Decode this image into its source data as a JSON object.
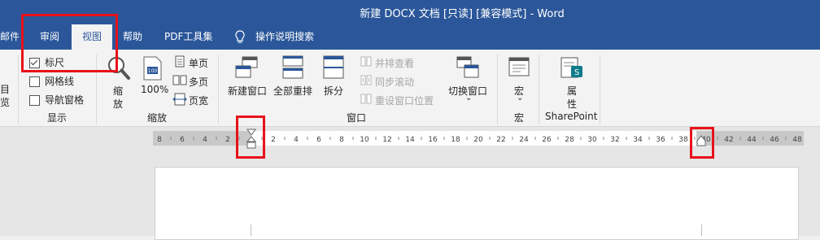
{
  "window": {
    "title": "新建 DOCX 文档 [只读] [兼容模式]  -  Word"
  },
  "tabs": [
    "邮件",
    "审阅",
    "视图",
    "帮助",
    "PDF工具集"
  ],
  "tell_me": {
    "label": "操作说明搜索",
    "icon": "lightbulb-icon"
  },
  "ribbon": {
    "show_group": {
      "label": "显示",
      "ruler": "标尺",
      "gridlines": "网格线",
      "nav_pane": "导航窗格",
      "ruler_checked": true,
      "gridlines_checked": false,
      "nav_pane_checked": false
    },
    "zoom_group": {
      "label": "缩放",
      "zoom_1": "缩",
      "zoom_2": "放",
      "hundred": "100%",
      "one_page": "单页",
      "multi_page": "多页",
      "page_width": "页宽"
    },
    "window_group": {
      "label": "窗口",
      "new_window": "新建窗口",
      "arrange_all": "全部重排",
      "split": "拆分",
      "side_by_side": "并排查看",
      "sync_scroll": "同步滚动",
      "reset_position": "重设窗口位置",
      "switch_window": "切换窗口",
      "switch_arrow": "⌄"
    },
    "macros_group": {
      "label": "宏",
      "macros": "宏",
      "macros_arrow": "⌄"
    },
    "sharepoint_group": {
      "label": "SharePoint",
      "props_1": "属",
      "props_2": "性"
    },
    "left_cut_1": "目",
    "left_cut_2": "览"
  },
  "ruler": {
    "left_labels": [
      "8",
      "6",
      "4",
      "2"
    ],
    "right_labels": [
      "2",
      "4",
      "6",
      "8",
      "10",
      "12",
      "14",
      "16",
      "18",
      "20",
      "22",
      "24",
      "26",
      "28",
      "30",
      "32",
      "34",
      "36",
      "38",
      "40",
      "42",
      "44",
      "46",
      "48"
    ]
  },
  "colors": {
    "title_bar": "#2b579a",
    "highlight": "#e8121a"
  }
}
